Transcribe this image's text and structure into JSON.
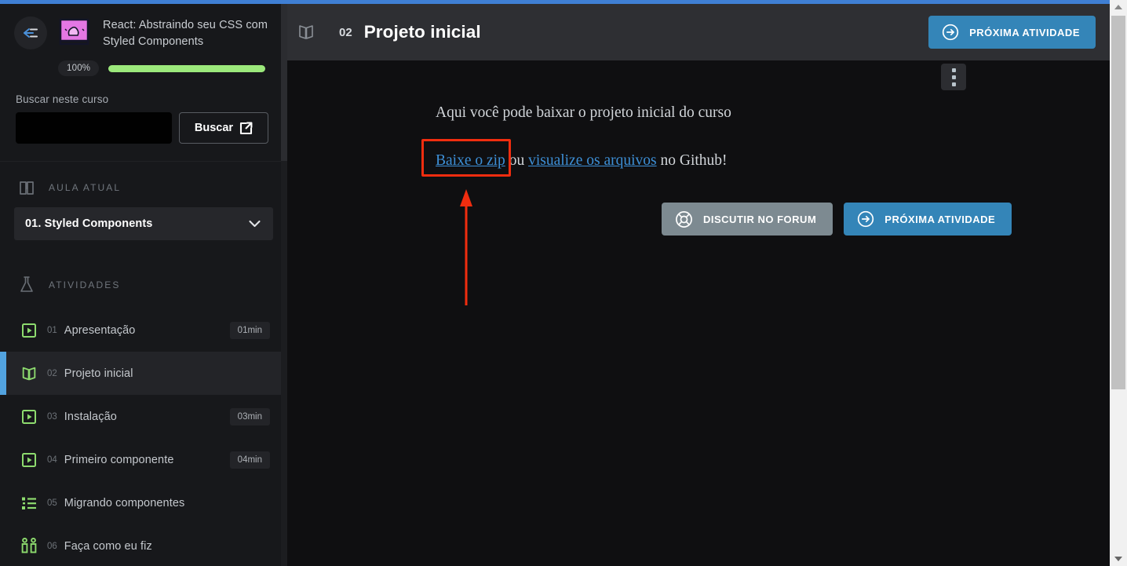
{
  "theme": {
    "accent_blue": "#3485b8",
    "indicator_blue": "#52a3e0",
    "progress_green": "#9be87b",
    "annotation_red": "#f02d0f",
    "sidebar_bg": "#17181b",
    "main_bg": "#0f0f11",
    "header_bg": "#2e2f33"
  },
  "sidebar": {
    "collapse_icon": "arrow-left-collapse-icon",
    "course_thumb_icon": "course-thumbnail",
    "course_title": "React: Abstraindo seu CSS com Styled Components",
    "progress": {
      "percent_label": "100%",
      "percent_value": 100
    },
    "search": {
      "label": "Buscar neste curso",
      "value": "",
      "placeholder": "",
      "button_label": "Buscar",
      "button_icon": "external-link-icon"
    },
    "current_section": {
      "heading": "AULA ATUAL",
      "heading_icon": "book-icon",
      "selected": "01. Styled Components",
      "chevron_icon": "chevron-down-icon"
    },
    "activities_section": {
      "heading": "ATIVIDADES",
      "heading_icon": "flask-icon",
      "items": [
        {
          "num": "01",
          "label": "Apresentação",
          "duration": "01min",
          "icon": "video-play-icon",
          "active": false
        },
        {
          "num": "02",
          "label": "Projeto inicial",
          "duration": "",
          "icon": "book-open-icon",
          "active": true
        },
        {
          "num": "03",
          "label": "Instalação",
          "duration": "03min",
          "icon": "video-play-icon",
          "active": false
        },
        {
          "num": "04",
          "label": "Primeiro componente",
          "duration": "04min",
          "icon": "video-play-icon",
          "active": false
        },
        {
          "num": "05",
          "label": "Migrando componentes",
          "duration": "",
          "icon": "list-icon",
          "active": false
        },
        {
          "num": "06",
          "label": "Faça como eu fiz",
          "duration": "",
          "icon": "people-icon",
          "active": false
        }
      ]
    }
  },
  "main": {
    "header": {
      "icon": "book-open-icon",
      "number": "02",
      "title": "Projeto inicial",
      "cta_label": "PRÓXIMA ATIVIDADE",
      "cta_icon": "arrow-right-circle-icon"
    },
    "kebab_icon": "more-vertical-icon",
    "content": {
      "paragraph": "Aqui você pode baixar o projeto inicial do curso",
      "link_zip": "Baixe o zip",
      "between_links": " ou ",
      "link_files": "visualize os arquivos",
      "tail_text": " no Github!"
    },
    "actions": [
      {
        "label": "DISCUTIR NO FORUM",
        "icon": "lifebuoy-icon",
        "style": "forum"
      },
      {
        "label": "PRÓXIMA ATIVIDADE",
        "icon": "arrow-right-circle-icon",
        "style": "next"
      }
    ]
  },
  "scrollbar": {
    "up_arrow": "scroll-up-arrow",
    "down_arrow": "scroll-down-arrow"
  }
}
